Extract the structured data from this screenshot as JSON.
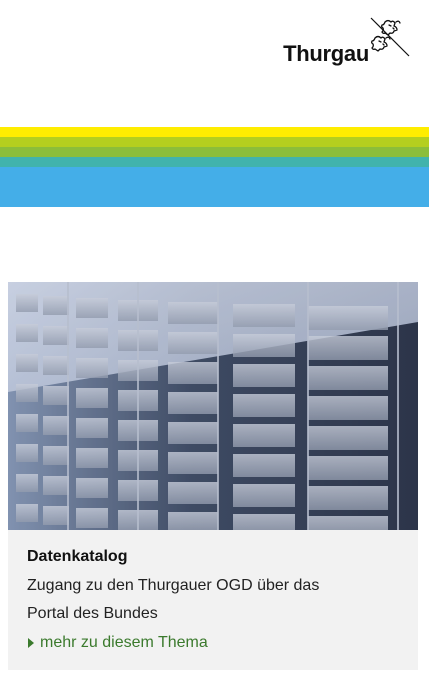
{
  "header": {
    "logo_text": "Thurgau",
    "logo_icon": "lion-coat-of-arms-icon"
  },
  "stripes": {
    "colors": [
      "#ffed00",
      "#b4cf1f",
      "#8bbe3a",
      "#41b3ac",
      "#44aee8"
    ]
  },
  "card": {
    "image": "server-rack-storage-photo",
    "title": "Datenkatalog",
    "description_line1": "Zugang zu den Thurgauer OGD über das",
    "description_line2": "Portal des Bundes",
    "link_text": "mehr zu diesem Thema",
    "link_icon": "triangle-right-icon",
    "link_color": "#3b7a2d",
    "background": "#f2f2f2"
  }
}
